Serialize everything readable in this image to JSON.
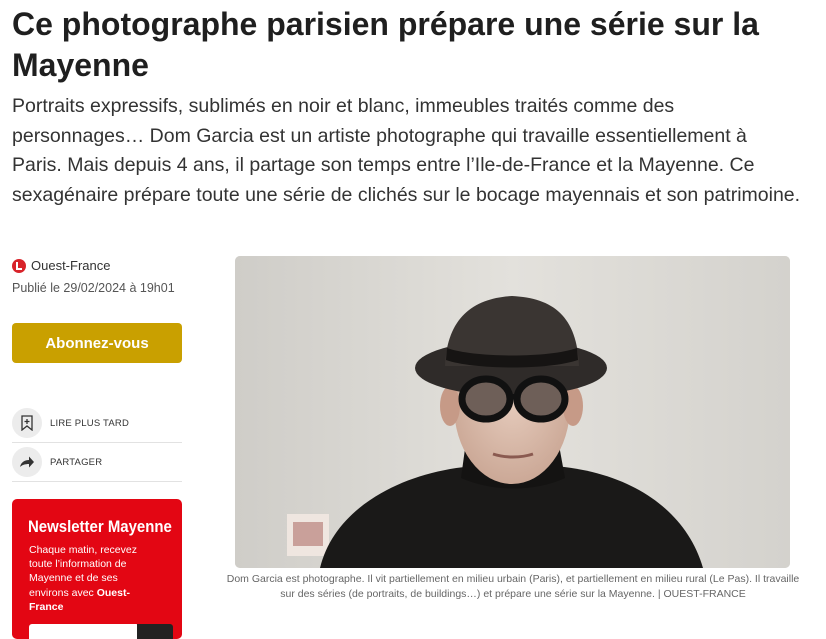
{
  "article": {
    "title": "Ce photographe parisien prépare une série sur la Mayenne",
    "lede": "Portraits expressifs, sublimés en noir et blanc, immeubles traités comme des personnages… Dom Garcia est un artiste photographe qui travaille essentiellement à Paris. Mais depuis 4 ans, il partage son temps entre l’Ile-de-France et la Mayenne. Ce sexagénaire prépare toute une série de clichés sur le bocage mayennais et son patrimoine.",
    "source": "Ouest-France",
    "published": "Publié le 29/02/2024 à 19h01",
    "source_icon": "ouest-france-logo-icon"
  },
  "sidebar": {
    "subscribe_label": "Abonnez-vous",
    "read_later_label": "LIRE PLUS TARD",
    "read_later_icon": "bookmark-plus-icon",
    "share_label": "PARTAGER",
    "share_icon": "share-arrow-icon"
  },
  "newsletter": {
    "title": "Newsletter Mayenne",
    "text_part1": "Chaque matin, recevez toute l’information de Mayenne et de ses environs avec ",
    "text_brand": "Ouest-France"
  },
  "photo": {
    "caption": "Dom Garcia est photographe. Il vit partiellement en milieu urbain (Paris), et partiellement en milieu rural (Le Pas). Il travaille sur des séries (de portraits, de buildings…) et prépare une série sur la Mayenne. | OUEST-FRANCE"
  },
  "colors": {
    "subscribe": "#c9a000",
    "newsletter": "#e30613",
    "brand_red": "#d8232a"
  }
}
